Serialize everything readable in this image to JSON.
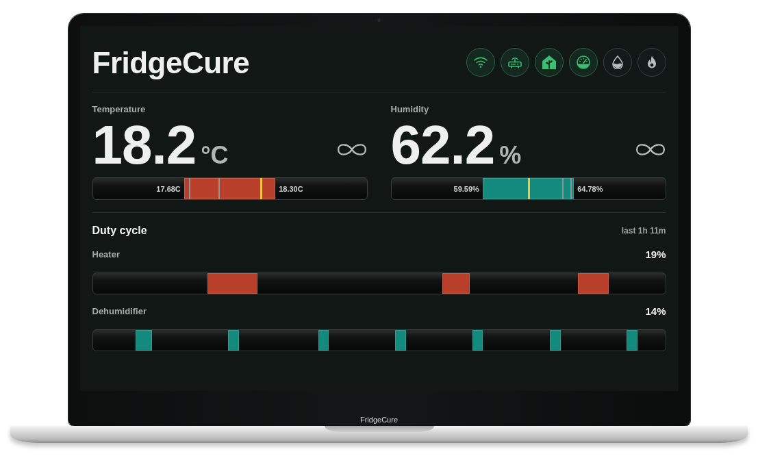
{
  "app": {
    "title": "FridgeCure"
  },
  "status_icons": [
    {
      "active": true
    },
    {
      "active": true
    },
    {
      "active": true
    },
    {
      "active": true
    },
    {
      "active": false
    },
    {
      "active": false
    }
  ],
  "metrics": [
    {
      "label": "Temperature",
      "value": "18.2",
      "unit": "°C",
      "color": "#b8402a",
      "range": {
        "low": "17.68C",
        "high": "18.30C",
        "markers": [
          {
            "kind": "tick",
            "level": 0.354
          },
          {
            "kind": "tick",
            "level": 0.462
          },
          {
            "kind": "current",
            "level": 0.613
          }
        ]
      }
    },
    {
      "label": "Humidity",
      "value": "62.2",
      "unit": "%",
      "color": "#138a7b",
      "range": {
        "low": "59.59%",
        "high": "64.78%",
        "markers": [
          {
            "kind": "current",
            "level": 0.5
          },
          {
            "kind": "tick",
            "level": 0.626
          },
          {
            "kind": "tick",
            "level": 0.657
          }
        ]
      }
    }
  ],
  "duty_cycle": {
    "title": "Duty cycle",
    "period": "last 1h 11m",
    "channels": [
      {
        "name": "Heater",
        "percent": "19%",
        "color": "#b8402a"
      },
      {
        "name": "Dehumidifier",
        "percent": "14%",
        "color": "#138a7b"
      }
    ]
  },
  "device": {
    "label": "FridgeCure"
  }
}
